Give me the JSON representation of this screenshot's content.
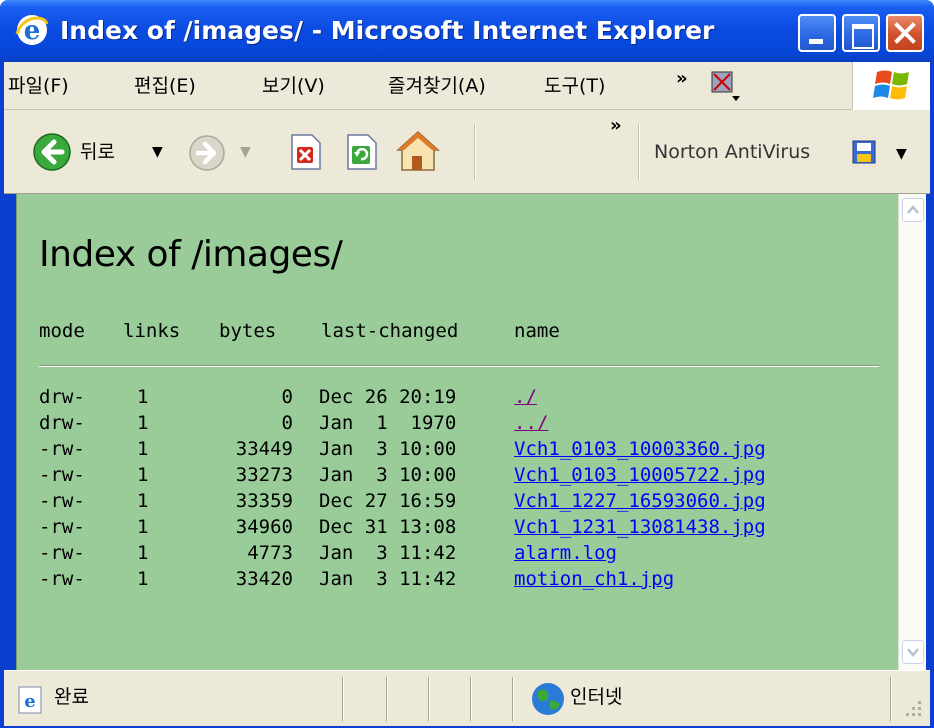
{
  "window": {
    "title": "Index of /images/ - Microsoft Internet Explorer"
  },
  "menu": [
    {
      "label": "파일(F)"
    },
    {
      "label": "편집(E)"
    },
    {
      "label": "보기(V)"
    },
    {
      "label": "즐겨찾기(A)"
    },
    {
      "label": "도구(T)"
    }
  ],
  "toolbar": {
    "back_label": "뒤로",
    "more": "»",
    "norton_label": "Norton AntiVirus"
  },
  "page": {
    "heading": "Index of /images/",
    "columns": {
      "mode": "mode",
      "links": "links",
      "bytes": "bytes",
      "last_changed": "last-changed",
      "name": "name"
    },
    "rows": [
      {
        "mode": "drw-",
        "links": "1",
        "bytes": "0",
        "date": "Dec 26 20:19",
        "name": "./"
      },
      {
        "mode": "drw-",
        "links": "1",
        "bytes": "0",
        "date": "Jan  1  1970",
        "name": "../"
      },
      {
        "mode": "-rw-",
        "links": "1",
        "bytes": "33449",
        "date": "Jan  3 10:00",
        "name": "Vch1_0103_10003360.jpg"
      },
      {
        "mode": "-rw-",
        "links": "1",
        "bytes": "33273",
        "date": "Jan  3 10:00",
        "name": "Vch1_0103_10005722.jpg"
      },
      {
        "mode": "-rw-",
        "links": "1",
        "bytes": "33359",
        "date": "Dec 27 16:59",
        "name": "Vch1_1227_16593060.jpg"
      },
      {
        "mode": "-rw-",
        "links": "1",
        "bytes": "34960",
        "date": "Dec 31 13:08",
        "name": "Vch1_1231_13081438.jpg"
      },
      {
        "mode": "-rw-",
        "links": "1",
        "bytes": "4773",
        "date": "Jan  3 11:42",
        "name": "alarm.log"
      },
      {
        "mode": "-rw-",
        "links": "1",
        "bytes": "33420",
        "date": "Jan  3 11:42",
        "name": "motion_ch1.jpg"
      }
    ]
  },
  "status": {
    "text": "완료",
    "zone": "인터넷"
  },
  "colors": {
    "page_background": "#99cc99",
    "link": "#0000ff",
    "visited_link": "#800080",
    "titlebar": "#0a4ae0"
  },
  "icons": [
    "ie-icon",
    "minimize-icon",
    "maximize-icon",
    "close-icon",
    "back-icon",
    "forward-icon",
    "stop-icon",
    "refresh-icon",
    "home-icon",
    "norton-icon",
    "windows-logo-icon",
    "internet-zone-icon"
  ]
}
